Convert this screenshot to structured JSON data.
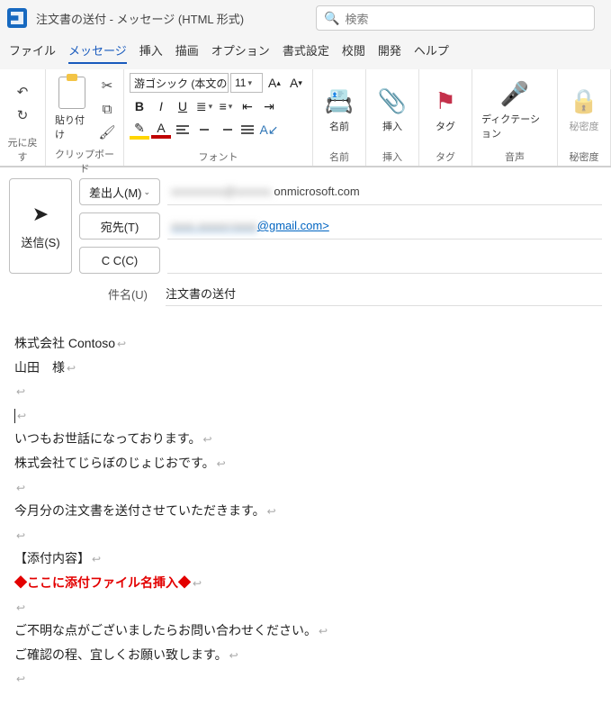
{
  "window": {
    "title": "注文書の送付 - メッセージ (HTML 形式)"
  },
  "search": {
    "placeholder": "検索"
  },
  "menu": {
    "file": "ファイル",
    "message": "メッセージ",
    "insert": "挿入",
    "draw": "描画",
    "options": "オプション",
    "format": "書式設定",
    "review": "校閲",
    "developer": "開発",
    "help": "ヘルプ"
  },
  "ribbon": {
    "undo_group": "元に戻す",
    "clipboard": {
      "paste": "貼り付け",
      "group": "クリップボード"
    },
    "font": {
      "name": "游ゴシック (本文のフ",
      "size": "11",
      "group": "フォント"
    },
    "names": {
      "label": "名前",
      "group": "名前"
    },
    "insert": {
      "label": "挿入",
      "group": "挿入"
    },
    "tag": {
      "label": "タグ",
      "group": "タグ"
    },
    "dictation": {
      "label": "ディクテーション",
      "group": "音声"
    },
    "sensitivity": {
      "label": "秘密度",
      "group": "秘密度"
    }
  },
  "compose": {
    "send": "送信(S)",
    "from_label": "差出人(M)",
    "from_value": "onmicrosoft.com",
    "to_label": "宛先(T)",
    "to_value": "@gmail.com>",
    "cc_label": "C C(C)",
    "subject_label": "件名(U)",
    "subject_value": "注文書の送付"
  },
  "body": {
    "l1": "株式会社 Contoso",
    "l2": "山田　様",
    "l5": "いつもお世話になっております。",
    "l6": "株式会社てじらぼのじょじおです。",
    "l8": "今月分の注文書を送付させていただきます。",
    "l10": "【添付内容】",
    "l11": "◆ここに添付ファイル名挿入◆",
    "l13": "ご不明な点がございましたらお問い合わせください。",
    "l14": "ご確認の程、宜しくお願い致します。"
  }
}
